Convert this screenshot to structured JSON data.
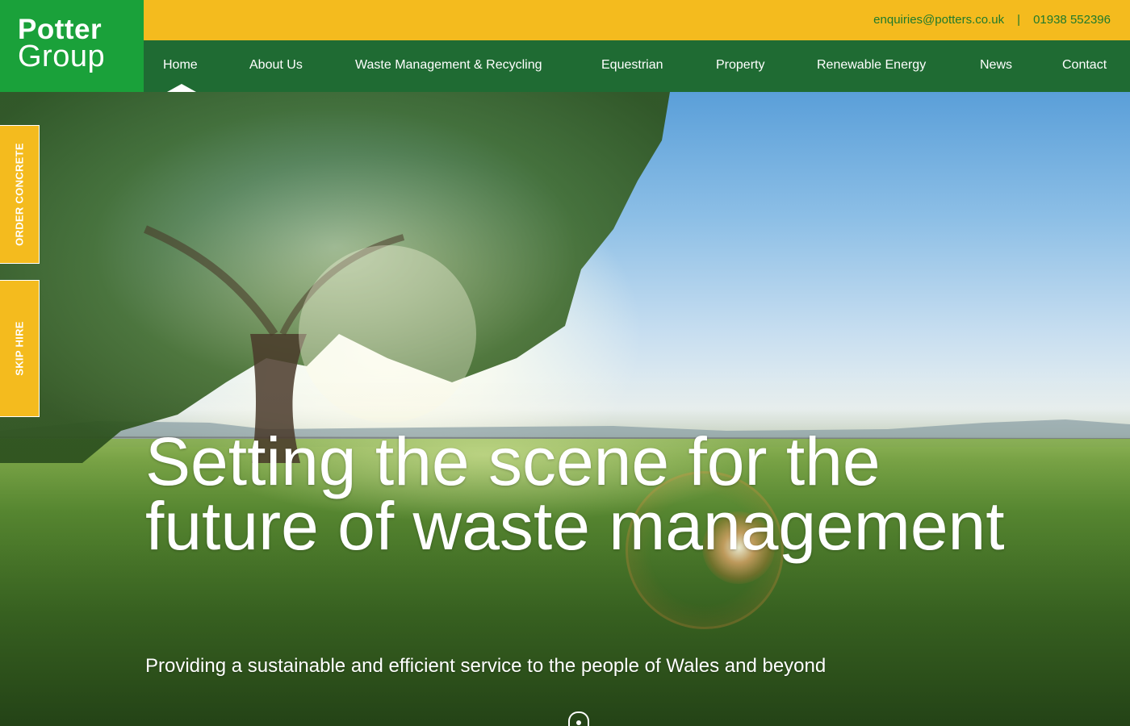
{
  "brand": {
    "logo_line1": "Potter",
    "logo_line2": "Group",
    "primary_green": "#1aa13a",
    "nav_green": "#1f6b33",
    "accent_yellow": "#f4bb1e"
  },
  "topbar": {
    "email": "enquiries@potters.co.uk",
    "separator": "|",
    "phone": "01938 552396"
  },
  "nav": {
    "active": "Home",
    "items": [
      {
        "label": "Home"
      },
      {
        "label": "About Us"
      },
      {
        "label": "Waste Management & Recycling"
      },
      {
        "label": "Equestrian"
      },
      {
        "label": "Property"
      },
      {
        "label": "Renewable Energy"
      },
      {
        "label": "News"
      },
      {
        "label": "Contact"
      }
    ]
  },
  "side_tabs": [
    {
      "label": "ORDER CONCRETE"
    },
    {
      "label": "SKIP HIRE"
    }
  ],
  "hero": {
    "title": "Setting the scene for the future of waste management",
    "subtitle": "Providing a sustainable and efficient service to the people of Wales and beyond",
    "scroll_icon": "mouse-scroll-icon"
  }
}
